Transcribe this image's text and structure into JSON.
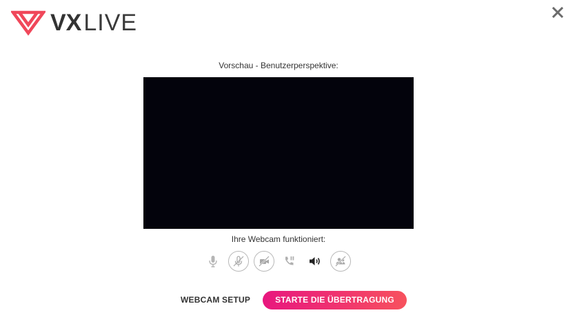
{
  "brand": {
    "logo_text_bold": "VX",
    "logo_text_light": "LIVE",
    "accent_color": "#f0475a"
  },
  "window": {
    "close_icon": "close-icon"
  },
  "preview": {
    "label": "Vorschau - Benutzerperspektive:",
    "video_background": "#03030c"
  },
  "status": {
    "label": "Ihre Webcam funktioniert:"
  },
  "controls": [
    {
      "name": "microphone-icon",
      "enabled": true
    },
    {
      "name": "microphone-off-icon",
      "enabled": false
    },
    {
      "name": "camera-off-icon",
      "enabled": false
    },
    {
      "name": "phone-call-icon",
      "enabled": true
    },
    {
      "name": "speaker-icon",
      "enabled": true
    },
    {
      "name": "users-off-icon",
      "enabled": false
    }
  ],
  "actions": {
    "setup_label": "WEBCAM SETUP",
    "start_label": "STARTE DIE ÜBERTRAGUNG",
    "start_gradient": [
      "#e8177e",
      "#f7525d"
    ]
  }
}
